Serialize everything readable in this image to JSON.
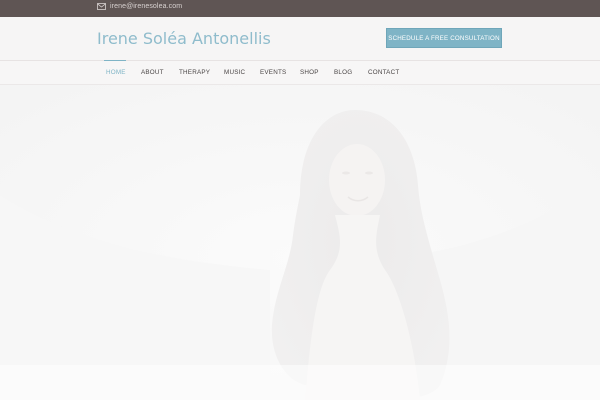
{
  "topbar": {
    "email": "irene@irenesolea.com",
    "mail_icon": "envelope-icon"
  },
  "header": {
    "site_title": "Irene Soléa Antonellis",
    "cta_label": "SCHEDULE A FREE CONSULTATION"
  },
  "nav": {
    "items": [
      {
        "label": "HOME",
        "active": true
      },
      {
        "label": "ABOUT"
      },
      {
        "label": "THERAPY"
      },
      {
        "label": "MUSIC"
      },
      {
        "label": "EVENTS"
      },
      {
        "label": "SHOP"
      },
      {
        "label": "BLOG"
      },
      {
        "label": "CONTACT"
      }
    ]
  },
  "hero": {
    "image": "portrait-photo",
    "overlay": "faded-white"
  },
  "colors": {
    "topbar_bg": "#5f5554",
    "accent": "#7fb4c6",
    "brand_text": "#8fbccc",
    "nav_text": "#4a4545"
  }
}
